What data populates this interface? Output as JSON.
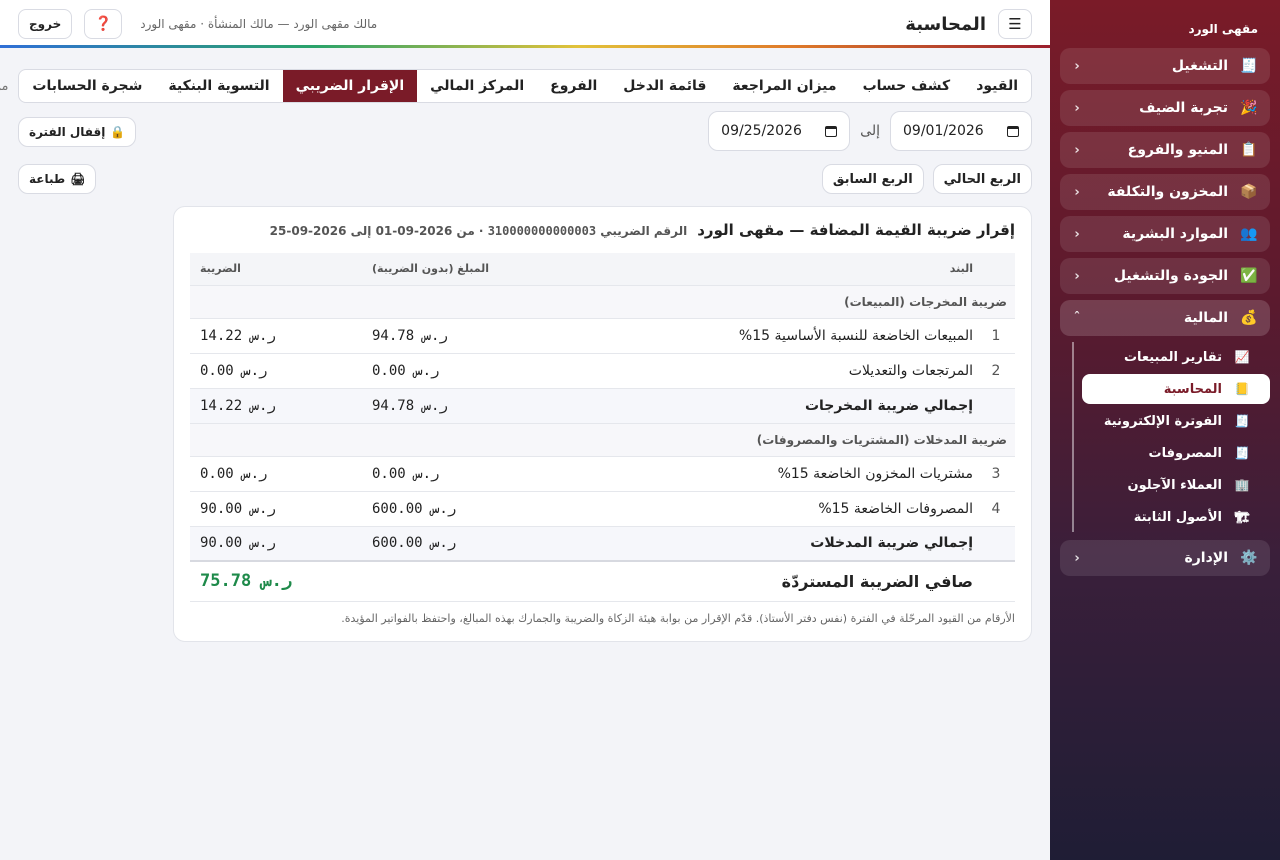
{
  "sidebar": {
    "brand": "مقهى الورد",
    "items": [
      {
        "icon": "🧾",
        "label": "التشغيل",
        "chev": "‹"
      },
      {
        "icon": "🎉",
        "label": "تجربة الضيف",
        "chev": "‹"
      },
      {
        "icon": "📋",
        "label": "المنيو والفروع",
        "chev": "‹"
      },
      {
        "icon": "📦",
        "label": "المخزون والتكلفة",
        "chev": "‹"
      },
      {
        "icon": "👥",
        "label": "الموارد البشرية",
        "chev": "‹"
      },
      {
        "icon": "✅",
        "label": "الجودة والتشغيل",
        "chev": "‹"
      },
      {
        "icon": "💰",
        "label": "المالية",
        "chev": "ˆ"
      }
    ],
    "finance_sub": [
      {
        "icon": "📈",
        "label": "تقارير المبيعات"
      },
      {
        "icon": "📒",
        "label": "المحاسبة"
      },
      {
        "icon": "🧾",
        "label": "الفوترة الإلكترونية"
      },
      {
        "icon": "🧾",
        "label": "المصروفات"
      },
      {
        "icon": "🏢",
        "label": "العملاء الآجلون"
      },
      {
        "icon": "🏗",
        "label": "الأصول الثابتة"
      }
    ],
    "admin": {
      "icon": "⚙️",
      "label": "الإدارة",
      "chev": "‹"
    }
  },
  "header": {
    "menu_icon": "☰",
    "title": "المحاسبة",
    "subtitle": "مالك مقهى الورد — مالك المنشأة · مقهى الورد",
    "help_icon": "❓",
    "logout": "خروج"
  },
  "tabs": [
    "القيود",
    "كشف حساب",
    "ميزان المراجعة",
    "قائمة الدخل",
    "الفروع",
    "المركز المالي",
    "الإقرار الضريبي",
    "التسوية البنكية",
    "شجرة الحسابات"
  ],
  "tabs_more": "من",
  "active_tab_index": 6,
  "period": {
    "from": "09/01/2026",
    "to_label": "إلى",
    "to": "09/25/2026",
    "lock": "إقفال الفترة",
    "lock_icon": "🔒",
    "current_quarter": "الربع الحالي",
    "previous_quarter": "الربع السابق",
    "print": "طباعة",
    "print_icon": "🖨"
  },
  "report": {
    "title": "إقرار ضريبة القيمة المضافة — مقهى الورد",
    "tin_label": "الرقم الضريبي",
    "tin": "310000000000003",
    "range": "· من 2026-09-01 إلى 2026-09-25",
    "columns": {
      "item": "البند",
      "amount": "المبلغ (بدون الضريبة)",
      "tax": "الضريبة"
    },
    "output_section": "ضريبة المخرجات (المبيعات)",
    "output_rows": [
      {
        "no": "1",
        "label": "المبيعات الخاضعة للنسبة الأساسية 15%",
        "amount": "ر.س 94.78",
        "tax": "ر.س 14.22"
      },
      {
        "no": "2",
        "label": "المرتجعات والتعديلات",
        "amount": "ر.س 0.00",
        "tax": "ر.س 0.00"
      }
    ],
    "output_total": {
      "label": "إجمالي ضريبة المخرجات",
      "amount": "ر.س 94.78",
      "tax": "ر.س 14.22"
    },
    "input_section": "ضريبة المدخلات (المشتريات والمصروفات)",
    "input_rows": [
      {
        "no": "3",
        "label": "مشتريات المخزون الخاضعة 15%",
        "amount": "ر.س 0.00",
        "tax": "ر.س 0.00"
      },
      {
        "no": "4",
        "label": "المصروفات الخاضعة 15%",
        "amount": "ر.س 600.00",
        "tax": "ر.س 90.00"
      }
    ],
    "input_total": {
      "label": "إجمالي ضريبة المدخلات",
      "amount": "ر.س 600.00",
      "tax": "ر.س 90.00"
    },
    "net": {
      "label": "صافي الضريبة المستردّة",
      "tax": "ر.س 75.78"
    },
    "footnote": "الأرقام من القيود المرحّلة في الفترة (نفس دفتر الأستاذ). قدّم الإقرار من بوابة هيئة الزكاة والضريبة والجمارك بهذه المبالغ، واحتفظ بالفواتير المؤيدة."
  }
}
